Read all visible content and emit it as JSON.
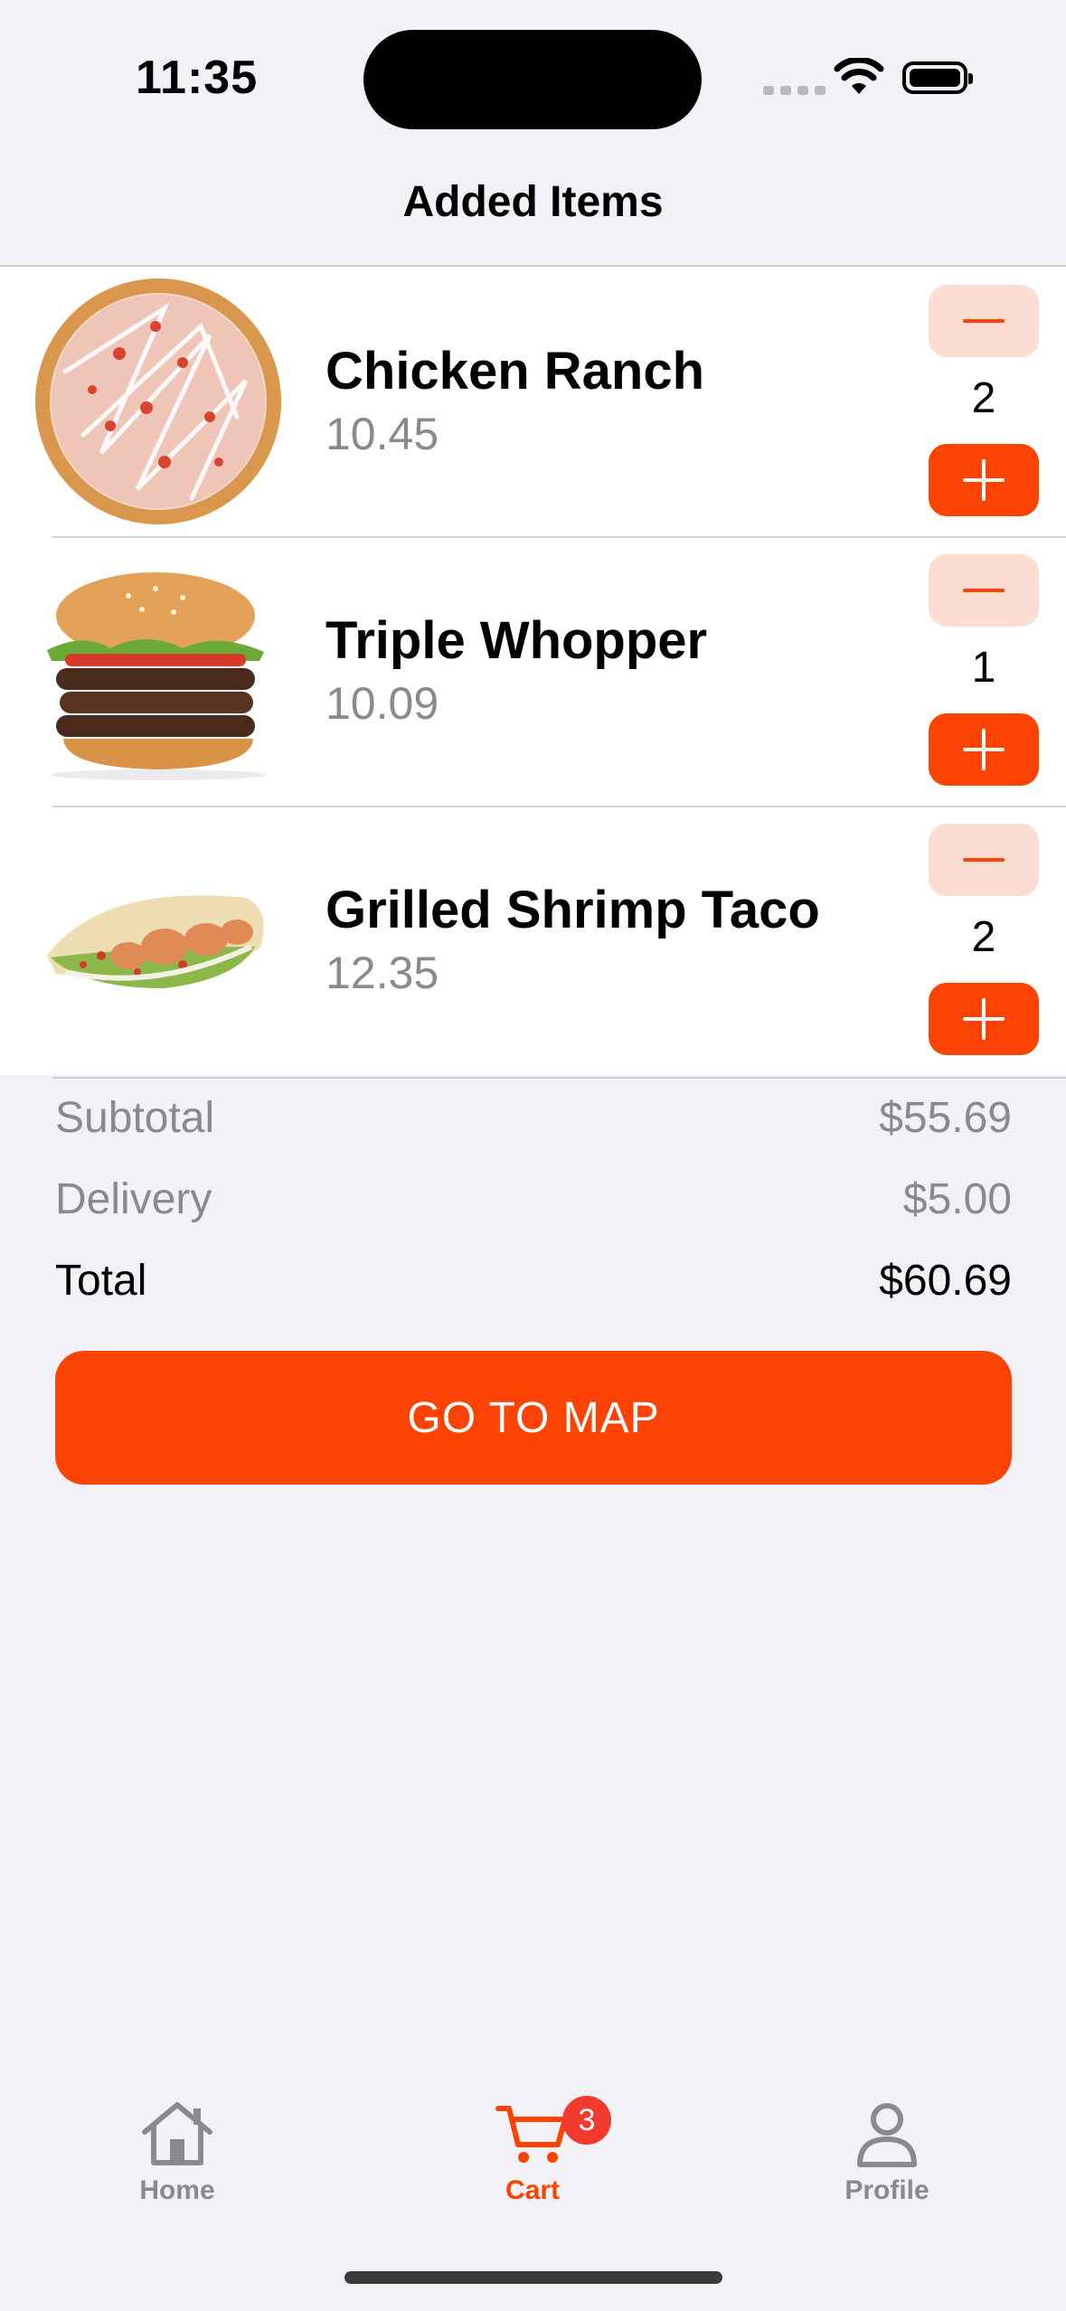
{
  "status_bar": {
    "time": "11:35"
  },
  "nav": {
    "title": "Added Items"
  },
  "cart": {
    "items": [
      {
        "name": "Chicken Ranch",
        "price": "10.45",
        "qty": "2",
        "image": "pizza"
      },
      {
        "name": "Triple Whopper",
        "price": "10.09",
        "qty": "1",
        "image": "burger"
      },
      {
        "name": "Grilled Shrimp Taco",
        "price": "12.35",
        "qty": "2",
        "image": "taco"
      }
    ]
  },
  "summary": {
    "subtotal_label": "Subtotal",
    "subtotal_value": "$55.69",
    "delivery_label": "Delivery",
    "delivery_value": "$5.00",
    "total_label": "Total",
    "total_value": "$60.69"
  },
  "actions": {
    "go_to_map": "GO TO MAP"
  },
  "tab_bar": {
    "home": "Home",
    "cart": "Cart",
    "cart_badge": "3",
    "profile": "Profile",
    "active": "cart"
  },
  "colors": {
    "accent": "#FC4304",
    "accent_light": "#FDDCD2",
    "badge": "#F03A2E",
    "muted": "#8A8A8E"
  }
}
